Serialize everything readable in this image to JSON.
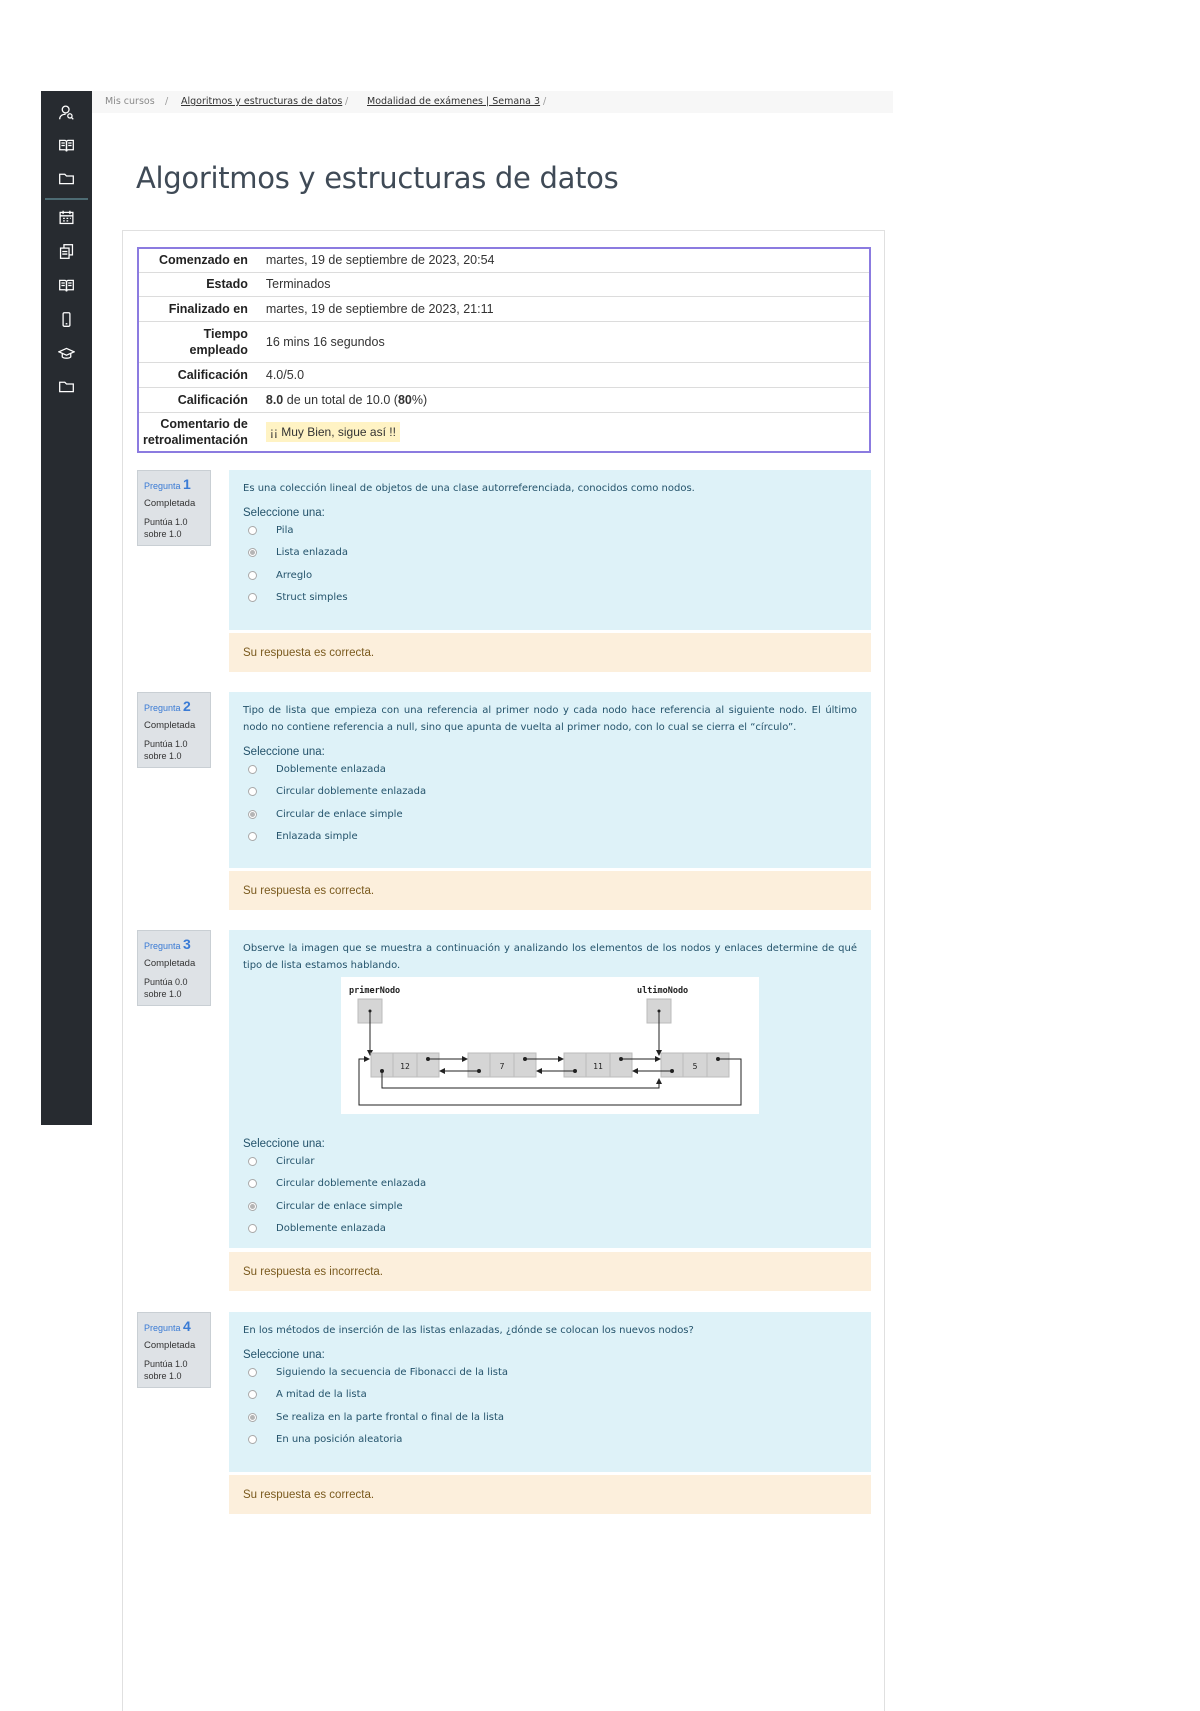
{
  "sidebar": {
    "icons": [
      "user-search-icon",
      "book-icon",
      "folder-icon",
      "calendar-icon",
      "documents-icon",
      "book-icon",
      "mobile-icon",
      "graduation-cap-icon",
      "folder-icon"
    ]
  },
  "breadcrumb": {
    "items": [
      "Mis cursos",
      "Algoritmos y estructuras de datos",
      "Modalidad de exámenes | Semana 3"
    ],
    "separator": "/"
  },
  "page": {
    "title": "Algoritmos y estructuras de datos"
  },
  "summary": {
    "rows": [
      {
        "label": "Comenzado en",
        "value": "martes, 19 de septiembre de 2023, 20:54"
      },
      {
        "label": "Estado",
        "value": "Terminados"
      },
      {
        "label": "Finalizado en",
        "value": "martes, 19 de septiembre de 2023, 21:11"
      },
      {
        "label": "Tiempo empleado",
        "value": "16 mins 16 segundos"
      },
      {
        "label": "Calificación",
        "value": "4.0/5.0"
      },
      {
        "label": "Calificación",
        "value_bold": "8.0",
        "value_mid": " de un total de 10.0 (",
        "value_bold2": "80",
        "value_end": "%)"
      },
      {
        "label": "Comentario de retroalimentación",
        "value": "¡¡ Muy Bien, sigue así !!"
      }
    ]
  },
  "questions": [
    {
      "label": "Pregunta",
      "number": "1",
      "state": "Completada",
      "grade": "Puntúa 1.0 sobre 1.0",
      "text": "Es una colección lineal de objetos de una clase autorreferenciada, conocidos como nodos.",
      "prompt": "Seleccione una:",
      "options": [
        "Pila",
        "Lista enlazada",
        "Arreglo",
        "Struct simples"
      ],
      "selected": 1,
      "feedback": "Su respuesta es correcta."
    },
    {
      "label": "Pregunta",
      "number": "2",
      "state": "Completada",
      "grade": "Puntúa 1.0 sobre 1.0",
      "text": "Tipo de lista que empieza con una referencia al primer nodo y cada nodo hace referencia al siguiente nodo. El último nodo no contiene referencia a null, sino que apunta de vuelta al primer nodo, con lo cual se cierra el “círculo”.",
      "prompt": "Seleccione una:",
      "options": [
        "Doblemente enlazada",
        "Circular doblemente enlazada",
        "Circular de enlace simple",
        "Enlazada simple"
      ],
      "selected": 2,
      "feedback": "Su respuesta es correcta."
    },
    {
      "label": "Pregunta",
      "number": "3",
      "state": "Completada",
      "grade": "Puntúa 0.0 sobre 1.0",
      "text": "Observe la imagen que se muestra a continuación y analizando los elementos de los nodos y enlaces determine de qué tipo de lista estamos hablando.",
      "diagram": {
        "first_label": "primerNodo",
        "last_label": "ultimoNodo",
        "nodes": [
          "12",
          "7",
          "11",
          "5"
        ]
      },
      "prompt": "Seleccione una:",
      "options": [
        "Circular",
        "Circular doblemente enlazada",
        "Circular de enlace simple",
        "Doblemente enlazada"
      ],
      "selected": 2,
      "feedback": "Su respuesta es incorrecta."
    },
    {
      "label": "Pregunta",
      "number": "4",
      "state": "Completada",
      "grade": "Puntúa 1.0 sobre 1.0",
      "text": "En los métodos de inserción de las listas enlazadas, ¿dónde se colocan los nuevos nodos?",
      "prompt": "Seleccione una:",
      "options": [
        "Siguiendo la secuencia de Fibonacci de la lista",
        "A mitad de la lista",
        "Se realiza en la parte frontal o final de la lista",
        "En una posición aleatoria"
      ],
      "selected": 2,
      "feedback": "Su respuesta es correcta."
    }
  ]
}
